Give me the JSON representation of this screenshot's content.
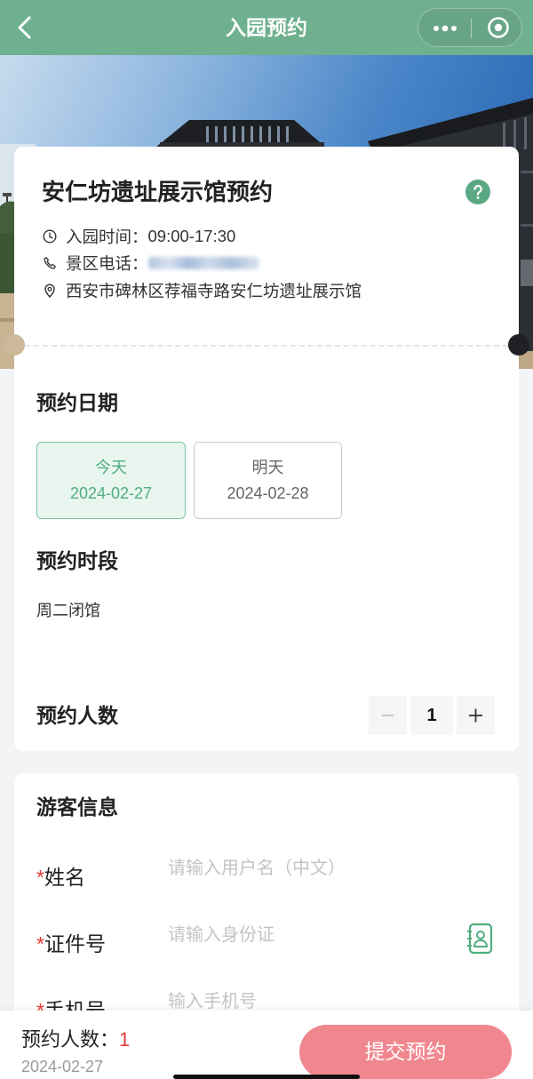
{
  "nav": {
    "title": "入园预约"
  },
  "icons": {
    "back": "chevron-left-icon",
    "more": "more-dots-icon",
    "capsule_close": "target-circle-icon",
    "help": "question-circle-icon",
    "hours": "clock-icon",
    "phone": "phone-icon",
    "address": "location-pin-icon",
    "decrement": "minus-icon",
    "increment": "plus-icon",
    "id_card": "contact-book-icon"
  },
  "colors": {
    "nav_green": "#6fb08f",
    "accent_green": "#4fae80",
    "selected_bg": "#e9f6ef",
    "help_green": "#5aa883",
    "required_red": "#e53935",
    "count_red": "#e53935",
    "submit_bg": "#f0878f"
  },
  "venue": {
    "title": "安仁坊遗址展示馆预约",
    "hours_label": "入园时间：",
    "hours": "09:00-17:30",
    "phone_label": "景区电话：",
    "address": "西安市碑林区荐福寺路安仁坊遗址展示馆"
  },
  "booking": {
    "date_heading": "预约日期",
    "dates": [
      {
        "label": "今天",
        "date": "2024-02-27",
        "selected": true
      },
      {
        "label": "明天",
        "date": "2024-02-28",
        "selected": false
      }
    ],
    "slot_heading": "预约时段",
    "slot_note": "周二闭馆",
    "count_heading": "预约人数",
    "count": 1
  },
  "visitor": {
    "heading": "游客信息",
    "fields": [
      {
        "required_mark": "*",
        "label": "姓名",
        "placeholder": "请输入用户名（中文）"
      },
      {
        "required_mark": "*",
        "label": "证件号",
        "placeholder": "请输入身份证"
      },
      {
        "required_mark": "*",
        "label": "手机号",
        "placeholder": "输入手机号"
      }
    ]
  },
  "footer": {
    "count_label": "预约人数：",
    "count": "1",
    "date": "2024-02-27",
    "submit_label": "提交预约"
  }
}
